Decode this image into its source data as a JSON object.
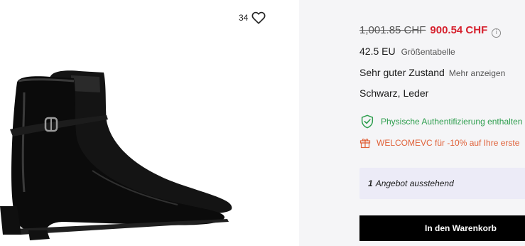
{
  "product": {
    "likes": "34",
    "price_old": "1,001.85 CHF",
    "price_new": "900.54 CHF",
    "info_icon": "i",
    "size": "42.5 EU",
    "size_chart_label": "Größentabelle",
    "condition": "Sehr guter Zustand",
    "more_label": "Mehr anzeigen",
    "color_material": "Schwarz, Leder",
    "authentication": "Physische Authentifizierung enthalten",
    "promo": "WELCOMEVC für -10% auf Ihre erste",
    "offer_count": "1",
    "offer_text": "Angebot ausstehend",
    "cart_button": "In den Warenkorb"
  },
  "icons": {
    "like": "heart-icon",
    "info": "info-icon",
    "authentication": "shield-check-icon",
    "promo": "gift-icon"
  },
  "colors": {
    "price_new": "#d6212e",
    "authentication": "#2e9e4e",
    "promo": "#e0623a",
    "offer_bg": "#ecebf7",
    "panel_bg": "#f5f5f7",
    "button_bg": "#000000"
  }
}
